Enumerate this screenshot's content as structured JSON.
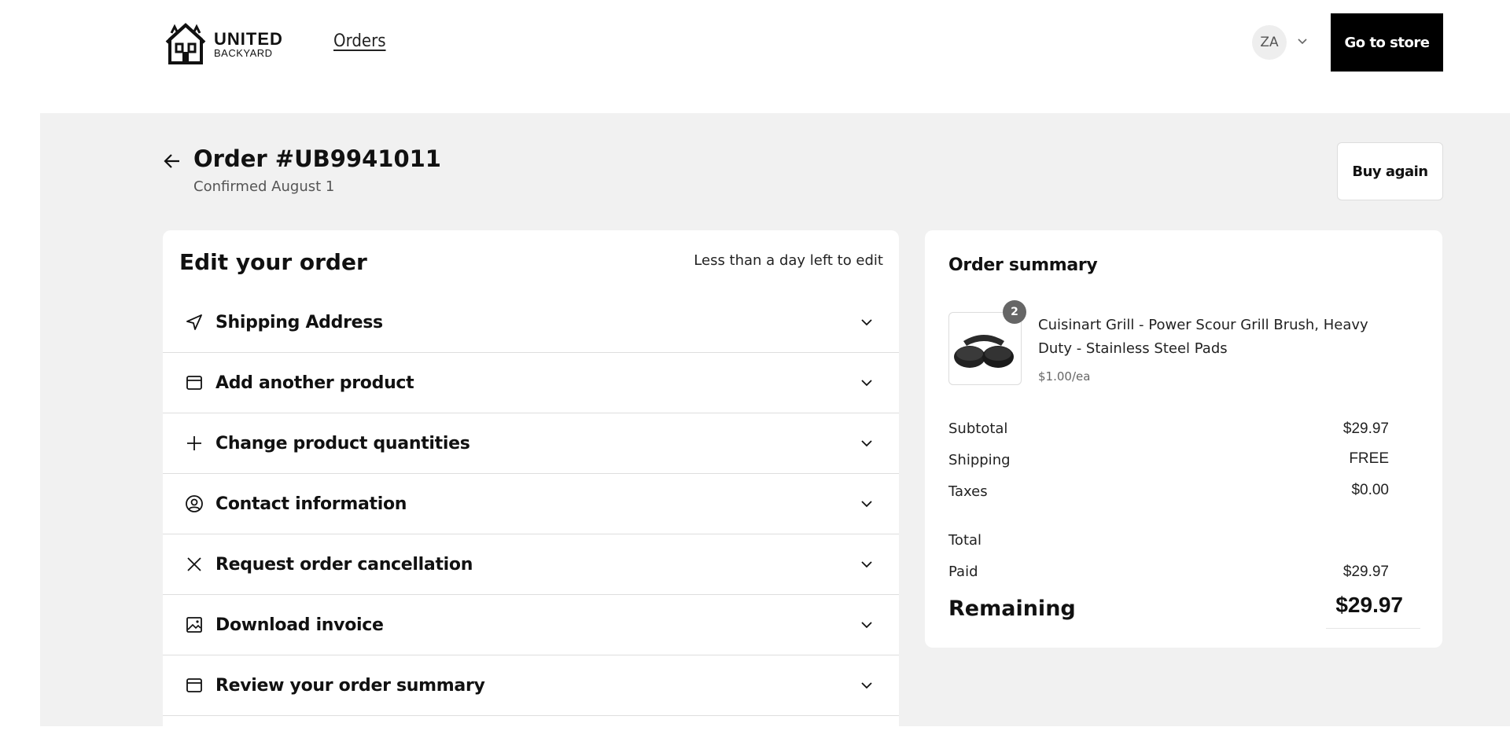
{
  "header": {
    "logo": {
      "line1": "UNITED",
      "line2": "BACKYARD"
    },
    "nav_orders": "Orders",
    "avatar_initials": "ZA",
    "go_to_store": "Go to store"
  },
  "order": {
    "title": "Order #UB9941011",
    "subtitle": "Confirmed August 1",
    "buy_again": "Buy again"
  },
  "edit": {
    "title": "Edit your order",
    "note": "Less than a day left to edit",
    "items": [
      {
        "label": "Shipping Address",
        "icon": "navigation-arrow-icon"
      },
      {
        "label": "Add another product",
        "icon": "box-icon"
      },
      {
        "label": "Change product quantities",
        "icon": "plus-icon"
      },
      {
        "label": "Contact information",
        "icon": "user-circle-icon"
      },
      {
        "label": "Request order cancellation",
        "icon": "x-icon"
      },
      {
        "label": "Download invoice",
        "icon": "image-icon"
      },
      {
        "label": "Review your order summary",
        "icon": "box-icon"
      }
    ]
  },
  "summary": {
    "title": "Order summary",
    "product": {
      "name": "Cuisinart Grill - Power Scour Grill Brush, Heavy Duty - Stainless Steel Pads",
      "price": "$1.00/ea",
      "quantity": "2"
    },
    "rows": {
      "subtotal_label": "Subtotal",
      "subtotal_value": "$29.97",
      "shipping_label": "Shipping",
      "shipping_value": "FREE",
      "taxes_label": "Taxes",
      "taxes_value": "$0.00",
      "total_label": "Total",
      "paid_label": "Paid",
      "paid_value": "$29.97"
    },
    "remaining_label": "Remaining",
    "remaining_value": "$29.97"
  }
}
